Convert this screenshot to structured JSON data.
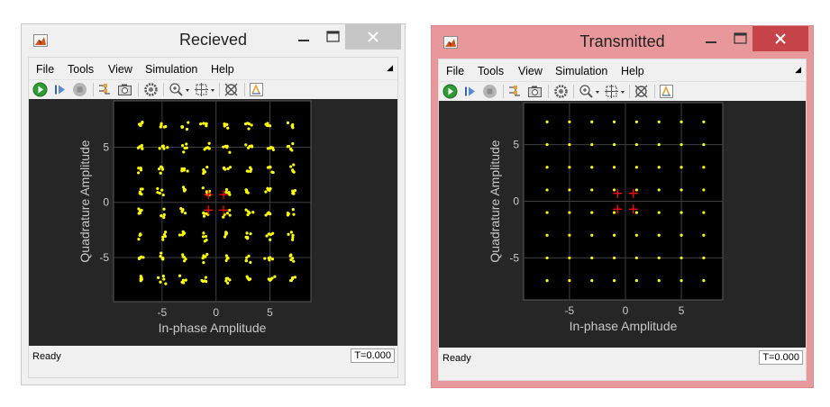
{
  "windows": [
    {
      "id": "received",
      "title": "Recieved",
      "menu": [
        "File",
        "Tools",
        "View",
        "Simulation",
        "Help"
      ],
      "toolbar": [
        "run-icon",
        "step-forward-icon",
        "stop-icon",
        "signal-select-icon",
        "camera-icon",
        "settings-icon",
        "zoom-icon",
        "fit-to-view-icon",
        "scale-axes-icon",
        "highlight-icon"
      ],
      "status": "Ready",
      "sim_time": "T=0.000",
      "chart_data": {
        "type": "scatter",
        "title": "",
        "xlabel": "In-phase Amplitude",
        "ylabel": "Quadrature Amplitude",
        "xlim": [
          -9.5,
          8.8
        ],
        "ylim": [
          -9,
          9.2
        ],
        "xticks": [
          -5,
          0,
          5
        ],
        "xtick_labels": [
          "-5",
          "0",
          "5"
        ],
        "yticks": [
          5,
          0,
          -5
        ],
        "ytick_labels": [
          "5",
          "0",
          "-5"
        ],
        "grid": true,
        "constellation_levels": [
          -7,
          -5,
          -3,
          -1,
          1,
          3,
          5,
          7
        ],
        "noise": true,
        "reference_points": [
          [
            -0.7,
            0.7
          ],
          [
            0.7,
            0.7
          ],
          [
            -0.7,
            -0.7
          ],
          [
            0.7,
            -0.7
          ]
        ],
        "point_color": "#ffff00",
        "reference_color": "#ff0000",
        "background": "#000000"
      }
    },
    {
      "id": "transmitted",
      "title": "Transmitted",
      "menu": [
        "File",
        "Tools",
        "View",
        "Simulation",
        "Help"
      ],
      "toolbar": [
        "run-icon",
        "step-forward-icon",
        "stop-icon",
        "signal-select-icon",
        "camera-icon",
        "settings-icon",
        "zoom-icon",
        "fit-to-view-icon",
        "scale-axes-icon",
        "highlight-icon"
      ],
      "status": "Ready",
      "sim_time": "T=0.000",
      "chart_data": {
        "type": "scatter",
        "title": "",
        "xlabel": "In-phase Amplitude",
        "ylabel": "Quadrature Amplitude",
        "xlim": [
          -9.1,
          8.7
        ],
        "ylim": [
          -8.7,
          8.7
        ],
        "xticks": [
          -5,
          0,
          5
        ],
        "xtick_labels": [
          "-5",
          "0",
          "5"
        ],
        "yticks": [
          5,
          0,
          -5
        ],
        "ytick_labels": [
          "5",
          "0",
          "-5"
        ],
        "grid": true,
        "constellation_levels": [
          -7,
          -5,
          -3,
          -1,
          1,
          3,
          5,
          7
        ],
        "noise": false,
        "reference_points": [
          [
            -0.7,
            0.7
          ],
          [
            0.7,
            0.7
          ],
          [
            -0.7,
            -0.7
          ],
          [
            0.7,
            -0.7
          ]
        ],
        "point_color": "#ffff00",
        "reference_color": "#ff0000",
        "background": "#000000"
      }
    }
  ],
  "colors": {
    "inactive_close": "#c6c6c6",
    "active_close": "#c7434a",
    "active_frame": "#e8989b",
    "plot_panel": "#262626",
    "axis_text": "#c8c8c8"
  }
}
